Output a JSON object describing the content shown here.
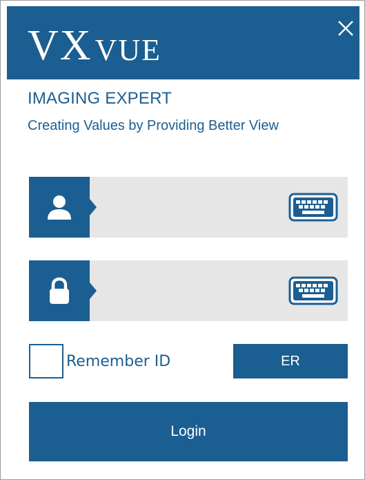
{
  "header": {
    "logo_main": "VX",
    "logo_sub": "VUE",
    "close_icon": "close-icon"
  },
  "brand": {
    "title": "IMAGING EXPERT",
    "subtitle": "Creating Values by Providing Better View"
  },
  "username_field": {
    "icon": "user-icon",
    "value": "",
    "keyboard_icon": "keyboard-icon"
  },
  "password_field": {
    "icon": "lock-icon",
    "value": "",
    "keyboard_icon": "keyboard-icon"
  },
  "remember": {
    "checked": false,
    "label": "Remember ID"
  },
  "er_button": {
    "label": "ER"
  },
  "login_button": {
    "label": "Login"
  },
  "colors": {
    "brand": "#1b5e91",
    "field_bg": "#e6e6e6",
    "background": "#ffffff"
  }
}
